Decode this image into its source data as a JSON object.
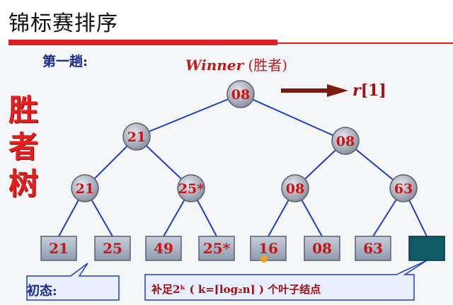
{
  "title": "锦标赛排序",
  "pass_label": "第一趟:",
  "winner_en": "Winner",
  "winner_cn": "(胜者)",
  "vertical_label": [
    "胜",
    "者",
    "树"
  ],
  "result_r": "r",
  "result_idx": "[1]",
  "tree": {
    "root": "08",
    "level1": [
      "21",
      "08"
    ],
    "level2": [
      "21",
      "25*",
      "08",
      "63"
    ],
    "leaves": [
      "21",
      "25",
      "49",
      "25*",
      "16",
      "08",
      "63",
      ""
    ]
  },
  "notes": {
    "initial": "初态:",
    "fill": "补足2ᵏ ( k=⌈log₂n⌉ ) 个叶子结点"
  },
  "colors": {
    "node_fill": "#a8adb8",
    "node_stroke": "#5a6070",
    "edge": "#1d3fbf",
    "leaf_fill": "#a7b2c4",
    "leaf_empty": "#0f5a66",
    "arrow": "#7a1a10",
    "callout_border": "#1d3fbf",
    "callout_fill": "#e8eefb"
  }
}
